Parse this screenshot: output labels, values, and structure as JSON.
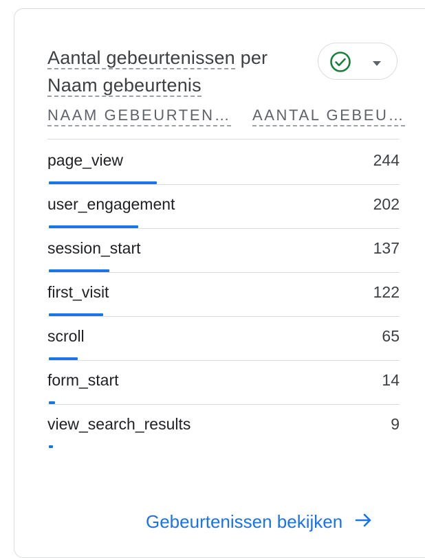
{
  "card": {
    "title_part1": "Aantal gebeurtenissen",
    "title_part2": " per",
    "title_part3": "Naam gebeurtenis",
    "status_icon": "check-circle-icon",
    "status_color": "#188038"
  },
  "table": {
    "headers": [
      "NAAM GEBEURTEN…",
      "AANTAL GEBEU…"
    ],
    "rows": [
      {
        "name": "page_view",
        "value": "244",
        "share": 1.0
      },
      {
        "name": "user_engagement",
        "value": "202",
        "share": 0.828
      },
      {
        "name": "session_start",
        "value": "137",
        "share": 0.561
      },
      {
        "name": "first_visit",
        "value": "122",
        "share": 0.5
      },
      {
        "name": "scroll",
        "value": "65",
        "share": 0.266
      },
      {
        "name": "form_start",
        "value": "14",
        "share": 0.057
      },
      {
        "name": "view_search_results",
        "value": "9",
        "share": 0.037
      }
    ],
    "bar_color": "#1a73e8"
  },
  "footer": {
    "link_label": "Gebeurtenissen bekijken",
    "link_icon": "arrow-right-icon"
  }
}
